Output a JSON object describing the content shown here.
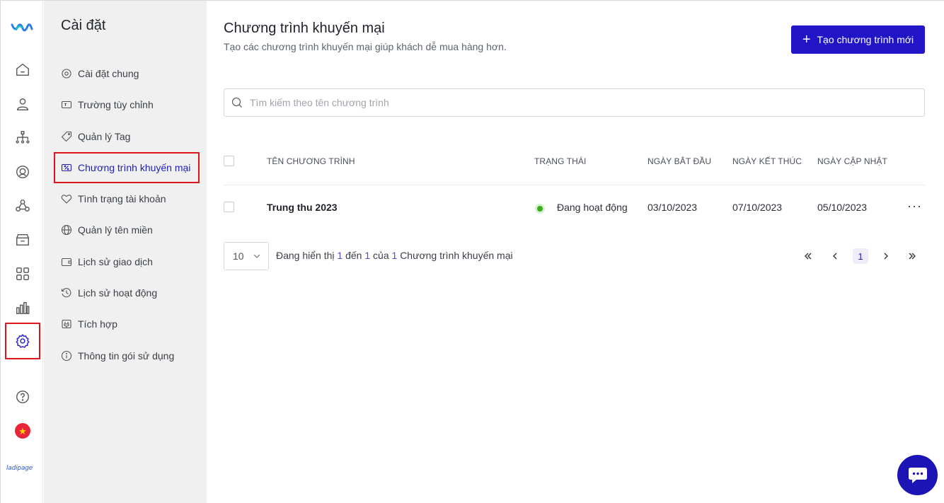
{
  "rail": {
    "items": [
      {
        "icon": "home-icon"
      },
      {
        "icon": "user-icon"
      },
      {
        "icon": "org-chart-icon"
      },
      {
        "icon": "target-icon"
      },
      {
        "icon": "network-icon"
      },
      {
        "icon": "inbox-icon"
      },
      {
        "icon": "apps-grid-icon"
      },
      {
        "icon": "bar-chart-icon"
      },
      {
        "icon": "gear-icon",
        "active": true
      },
      {
        "icon": "help-icon"
      },
      {
        "icon": "vietnam-flag-icon"
      }
    ],
    "brand": "ladipage",
    "highlight_color": "#e0141e"
  },
  "settings": {
    "title": "Cài đặt",
    "items": [
      {
        "label": "Cài đặt chung",
        "icon": "gear-icon"
      },
      {
        "label": "Trường tùy chỉnh",
        "icon": "custom-field-icon"
      },
      {
        "label": "Quản lý Tag",
        "icon": "tag-icon"
      },
      {
        "label": "Chương trình khuyến mại",
        "icon": "coupon-icon",
        "active": true
      },
      {
        "label": "Tình trạng tài khoản",
        "icon": "heart-icon"
      },
      {
        "label": "Quản lý tên miền",
        "icon": "globe-icon"
      },
      {
        "label": "Lịch sử giao dịch",
        "icon": "wallet-icon"
      },
      {
        "label": "Lịch sử hoạt động",
        "icon": "history-icon"
      },
      {
        "label": "Tích hợp",
        "icon": "plug-icon"
      },
      {
        "label": "Thông tin gói sử dụng",
        "icon": "info-icon"
      }
    ]
  },
  "main": {
    "title": "Chương trình khuyến mại",
    "subtitle": "Tạo các chương trình khuyến mại giúp khách dễ mua hàng hơn.",
    "new_button": "Tạo chương trình mới",
    "search_placeholder": "Tìm kiếm theo tên chương trình",
    "accent_color": "#2215c8",
    "table": {
      "columns": [
        "TÊN CHƯƠNG TRÌNH",
        "TRẠNG THÁI",
        "NGÀY BẮT ĐẦU",
        "NGÀY KẾT THÚC",
        "NGÀY CẬP NHẬT"
      ],
      "rows": [
        {
          "name": "Trung thu 2023",
          "status": "Đang hoạt động",
          "start": "03/10/2023",
          "end": "07/10/2023",
          "updated": "05/10/2023",
          "more": "···"
        }
      ]
    },
    "pagination": {
      "page_size": "10",
      "info_prefix": "Đang hiển thị",
      "from": "1",
      "to_word": "đến",
      "to": "1",
      "of_word": "của",
      "total": "1",
      "suffix": "Chương trình khuyến mại",
      "current_page": "1"
    }
  }
}
